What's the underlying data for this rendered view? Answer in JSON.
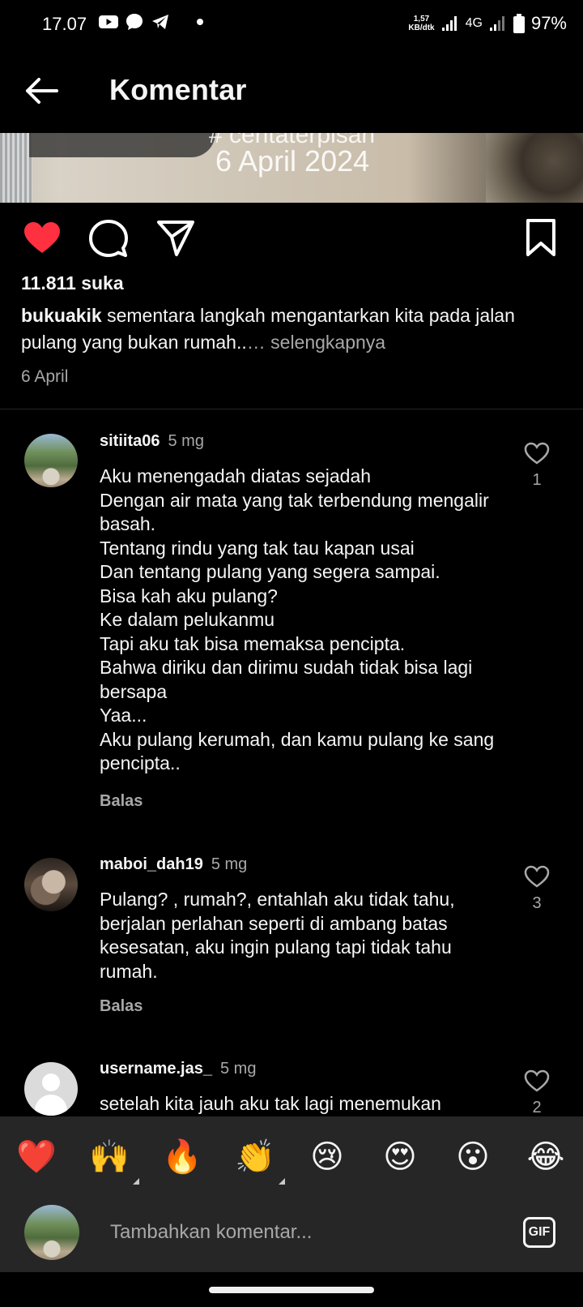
{
  "status_bar": {
    "time": "17.07",
    "net_speed_value": "1,57",
    "net_speed_unit": "KB/dtk",
    "network": "4G",
    "battery": "97%"
  },
  "header": {
    "title": "Komentar"
  },
  "post": {
    "image_text_line1": "# ceritaterpisah",
    "image_text_line2": "6 April 2024",
    "likes": "11.811 suka",
    "caption_user": "bukuakik",
    "caption_text": "sementara langkah mengantarkan kita pada jalan pulang yang bukan rumah..",
    "caption_more": "… selengkapnya",
    "date": "6 April"
  },
  "comments": [
    {
      "user": "sitiita06",
      "time": "5 mg",
      "text": "Aku menengadah diatas sejadah\nDengan air mata yang tak terbendung mengalir basah.\nTentang rindu yang tak tau kapan usai\nDan tentang pulang yang segera sampai.\nBisa kah aku pulang?\nKe dalam pelukanmu\nTapi aku tak bisa memaksa pencipta.\nBahwa diriku dan dirimu sudah tidak bisa lagi bersapa\nYaa...\nAku pulang kerumah, dan kamu pulang ke sang pencipta..",
      "reply": "Balas",
      "likes": "1"
    },
    {
      "user": "maboi_dah19",
      "time": "5 mg",
      "text": "Pulang? , rumah?, entahlah aku tidak tahu, berjalan perlahan seperti di ambang batas kesesatan, aku ingin pulang tapi tidak tahu rumah.",
      "reply": "Balas",
      "likes": "3"
    },
    {
      "user": "username.jas_",
      "time": "5 mg",
      "text": "setelah kita jauh aku tak lagi menemukan",
      "reply": "",
      "likes": "2"
    }
  ],
  "emoji_bar": [
    "❤️",
    "🙌",
    "🔥",
    "👏",
    "😢",
    "😍",
    "😮",
    "😂"
  ],
  "compose": {
    "placeholder": "Tambahkan komentar...",
    "gif_label": "GIF"
  }
}
